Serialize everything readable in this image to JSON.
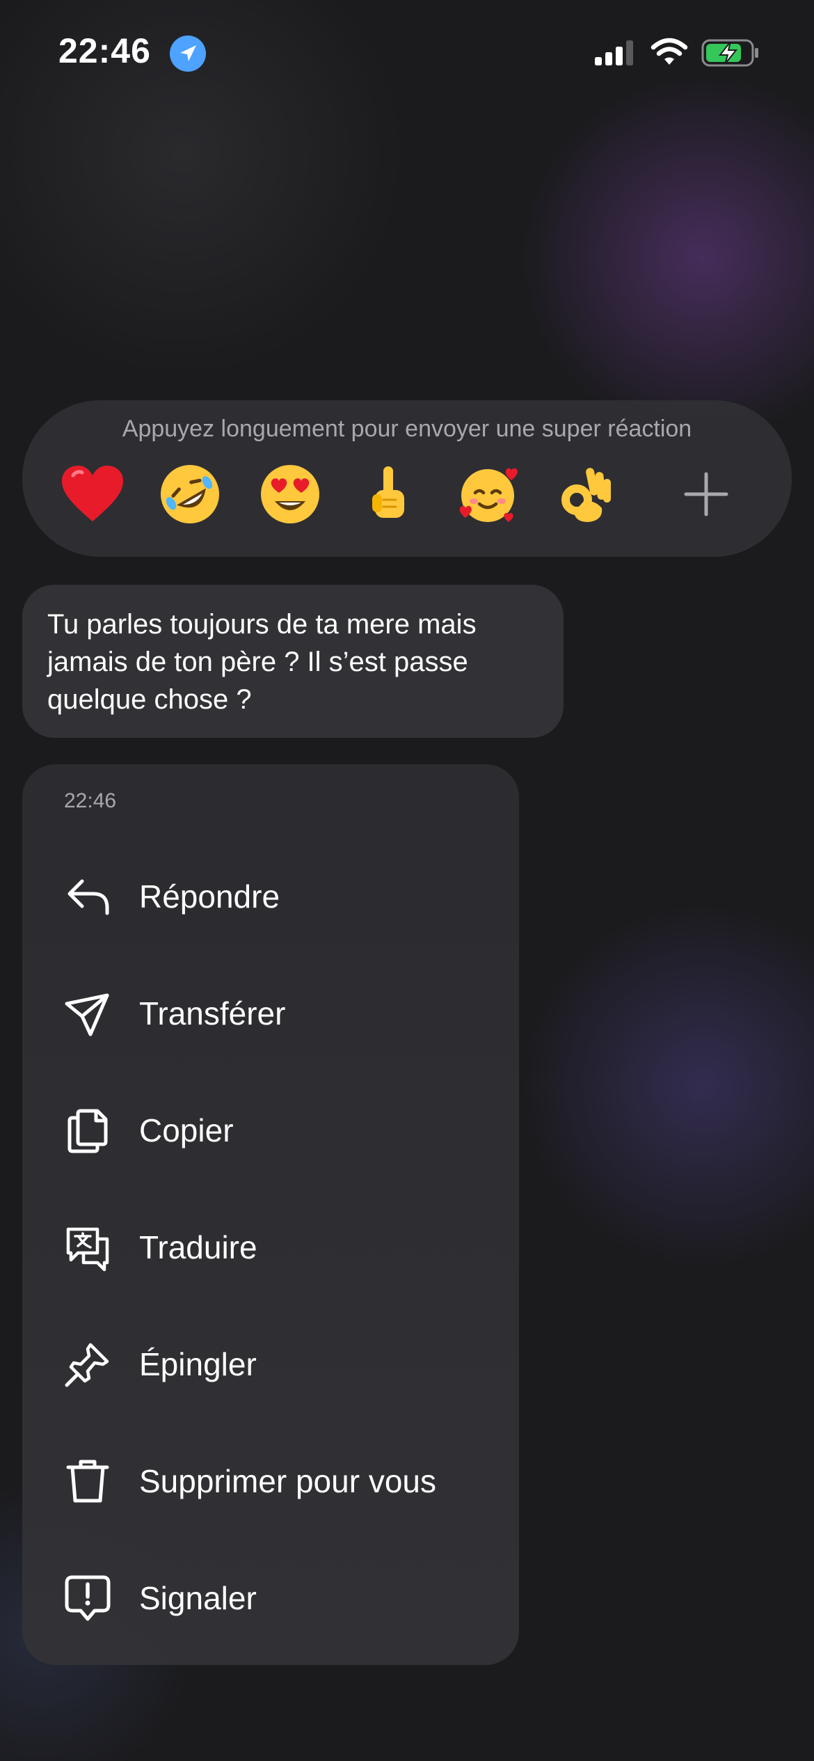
{
  "status_bar": {
    "time": "22:46",
    "icons": [
      "location-arrow-icon",
      "cellular-signal-icon",
      "wifi-icon",
      "battery-charging-icon"
    ],
    "accent_color": "#4da3ff",
    "battery_color": "#34c759"
  },
  "reactions": {
    "hint": "Appuyez longuement pour envoyer une super réaction",
    "emojis": [
      "❤",
      "🤣",
      "😍",
      "🖕",
      "🥰",
      "👌"
    ],
    "more_icon": "plus-icon"
  },
  "message": {
    "text": "Tu parles toujours de ta mere mais jamais de ton père ? Il s’est passe quelque chose ?"
  },
  "menu": {
    "time": "22:46",
    "items": [
      {
        "label": "Répondre",
        "icon": "reply-icon"
      },
      {
        "label": "Transférer",
        "icon": "send-icon"
      },
      {
        "label": "Copier",
        "icon": "copy-icon"
      },
      {
        "label": "Traduire",
        "icon": "translate-icon"
      },
      {
        "label": "Épingler",
        "icon": "pin-icon"
      },
      {
        "label": "Supprimer pour vous",
        "icon": "trash-icon"
      },
      {
        "label": "Signaler",
        "icon": "report-icon"
      }
    ]
  }
}
